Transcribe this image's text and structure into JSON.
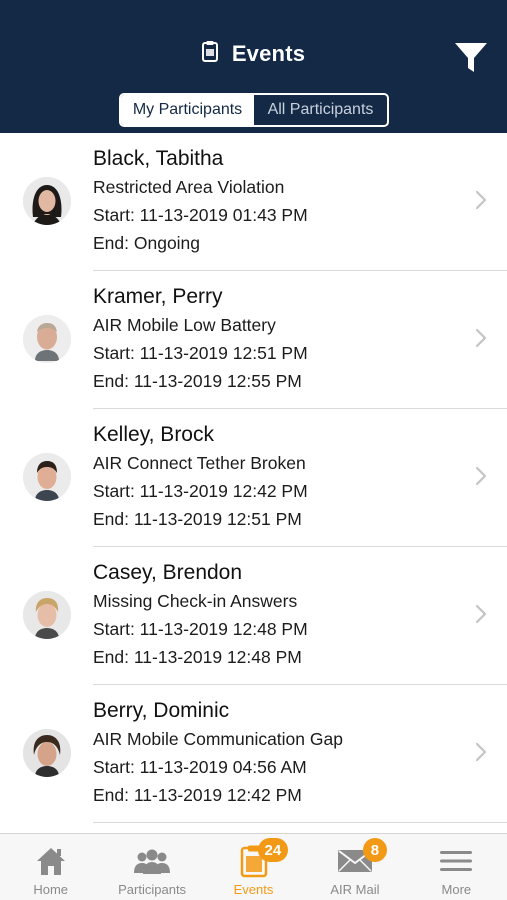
{
  "header": {
    "title": "Events",
    "segments": [
      {
        "label": "My Participants",
        "selected": true
      },
      {
        "label": "All Participants",
        "selected": false
      }
    ],
    "filter_icon": "filter-icon"
  },
  "events": [
    {
      "name": "Black, Tabitha",
      "event": "Restricted Area Violation",
      "start": "Start: 11-13-2019 01:43 PM",
      "end": "End: Ongoing"
    },
    {
      "name": "Kramer, Perry",
      "event": "AIR Mobile Low Battery",
      "start": "Start: 11-13-2019 12:51 PM",
      "end": "End: 11-13-2019 12:55 PM"
    },
    {
      "name": "Kelley, Brock",
      "event": "AIR Connect Tether Broken",
      "start": "Start: 11-13-2019 12:42 PM",
      "end": "End: 11-13-2019 12:51 PM"
    },
    {
      "name": "Casey, Brendon",
      "event": "Missing Check-in Answers",
      "start": "Start: 11-13-2019 12:48 PM",
      "end": "End: 11-13-2019 12:48 PM"
    },
    {
      "name": "Berry, Dominic",
      "event": "AIR Mobile Communication Gap",
      "start": "Start: 11-13-2019 04:56 AM",
      "end": "End: 11-13-2019 12:42 PM"
    }
  ],
  "tabbar": {
    "home": {
      "label": "Home"
    },
    "participants": {
      "label": "Participants"
    },
    "events": {
      "label": "Events",
      "badge": "24"
    },
    "airmail": {
      "label": "AIR Mail",
      "badge": "8"
    },
    "more": {
      "label": "More"
    }
  },
  "colors": {
    "header_bg": "#132945",
    "accent": "#f29a16",
    "divider": "#d9d9d9",
    "tab_inactive": "#8a8a8a"
  }
}
